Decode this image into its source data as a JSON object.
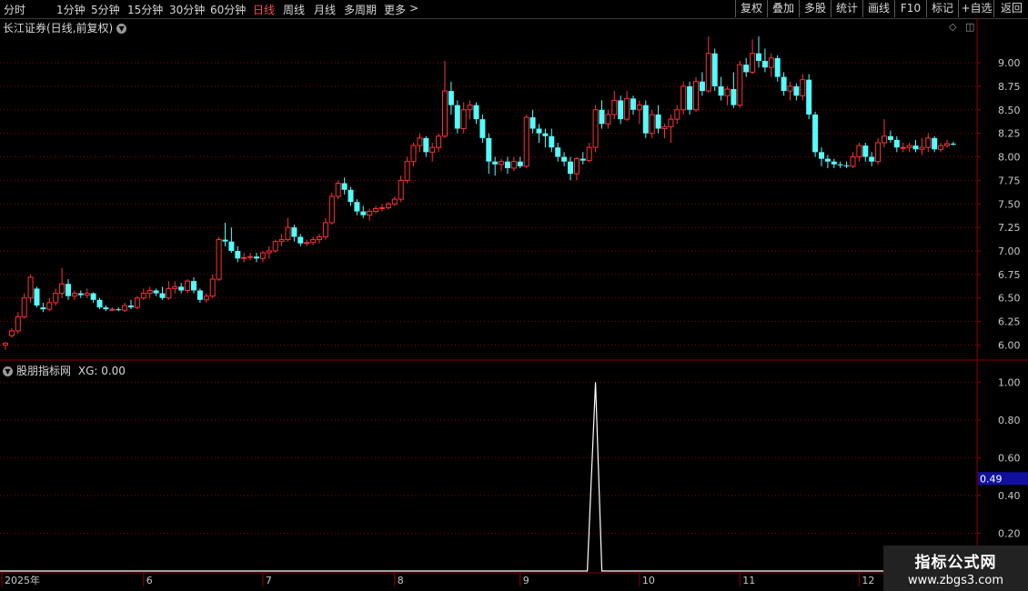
{
  "periods": [
    "分时",
    "1分钟",
    "5分钟",
    "15分钟",
    "30分钟",
    "60分钟",
    "日线",
    "周线",
    "月线",
    "多周期",
    "更多"
  ],
  "active_period": "日线",
  "more_chevron": ">",
  "right_buttons": [
    "复权",
    "叠加",
    "多股",
    "统计",
    "画线",
    "F10",
    "标记",
    "+自选",
    "返回"
  ],
  "stock_title": "长江证券(日线,前复权)",
  "indicator_title": "股朋指标网",
  "indicator_value": "XG: 0.00",
  "indicator_current_badge": "0.49",
  "watermark": {
    "line1": "指标公式网",
    "line2": "www.zbgs3.com"
  },
  "colors": {
    "up": "#ff3232",
    "down": "#54fcfc",
    "grid": "#8b0000",
    "indicator": "#ffffff",
    "badge": "#1010a0"
  },
  "chart_data": [
    {
      "type": "candlestick",
      "title": "长江证券(日线,前复权)",
      "ylim": [
        5.85,
        9.3
      ],
      "yticks": [
        "6.00",
        "6.25",
        "6.50",
        "6.75",
        "7.00",
        "7.25",
        "7.50",
        "7.75",
        "8.00",
        "8.25",
        "8.50",
        "8.75",
        "9.00"
      ],
      "x_labels": [
        "2025年",
        "6",
        "7",
        "8",
        "9",
        "10",
        "11",
        "12"
      ],
      "x_label_index": [
        0,
        22,
        41,
        62,
        82,
        101,
        117,
        136
      ],
      "ohlc": [
        [
          6.0,
          6.03,
          5.95,
          6.02
        ],
        [
          6.1,
          6.18,
          6.08,
          6.15
        ],
        [
          6.15,
          6.35,
          6.12,
          6.3
        ],
        [
          6.3,
          6.55,
          6.28,
          6.5
        ],
        [
          6.5,
          6.75,
          6.45,
          6.72
        ],
        [
          6.6,
          6.62,
          6.4,
          6.42
        ],
        [
          6.4,
          6.45,
          6.35,
          6.38
        ],
        [
          6.38,
          6.5,
          6.36,
          6.45
        ],
        [
          6.45,
          6.6,
          6.42,
          6.55
        ],
        [
          6.55,
          6.82,
          6.5,
          6.65
        ],
        [
          6.65,
          6.7,
          6.48,
          6.52
        ],
        [
          6.52,
          6.58,
          6.48,
          6.55
        ],
        [
          6.55,
          6.58,
          6.5,
          6.53
        ],
        [
          6.53,
          6.6,
          6.5,
          6.55
        ],
        [
          6.55,
          6.56,
          6.45,
          6.48
        ],
        [
          6.48,
          6.5,
          6.38,
          6.4
        ],
        [
          6.4,
          6.42,
          6.36,
          6.38
        ],
        [
          6.38,
          6.4,
          6.36,
          6.38
        ],
        [
          6.38,
          6.4,
          6.36,
          6.37
        ],
        [
          6.37,
          6.45,
          6.35,
          6.42
        ],
        [
          6.42,
          6.48,
          6.38,
          6.4
        ],
        [
          6.4,
          6.52,
          6.38,
          6.5
        ],
        [
          6.5,
          6.6,
          6.48,
          6.55
        ],
        [
          6.55,
          6.62,
          6.5,
          6.58
        ],
        [
          6.58,
          6.6,
          6.52,
          6.55
        ],
        [
          6.55,
          6.62,
          6.48,
          6.5
        ],
        [
          6.5,
          6.68,
          6.48,
          6.6
        ],
        [
          6.6,
          6.68,
          6.55,
          6.62
        ],
        [
          6.62,
          6.66,
          6.55,
          6.58
        ],
        [
          6.58,
          6.7,
          6.55,
          6.68
        ],
        [
          6.68,
          6.72,
          6.55,
          6.58
        ],
        [
          6.58,
          6.6,
          6.45,
          6.48
        ],
        [
          6.48,
          6.55,
          6.45,
          6.52
        ],
        [
          6.52,
          6.75,
          6.5,
          6.7
        ],
        [
          6.7,
          7.15,
          6.68,
          7.12
        ],
        [
          7.12,
          7.3,
          7.05,
          7.1
        ],
        [
          7.1,
          7.25,
          6.98,
          7.0
        ],
        [
          7.0,
          7.05,
          6.88,
          6.92
        ],
        [
          6.92,
          6.98,
          6.88,
          6.93
        ],
        [
          6.93,
          6.98,
          6.9,
          6.94
        ],
        [
          6.94,
          6.98,
          6.88,
          6.92
        ],
        [
          6.92,
          7.0,
          6.88,
          6.98
        ],
        [
          6.98,
          7.05,
          6.92,
          7.0
        ],
        [
          7.0,
          7.12,
          6.98,
          7.1
        ],
        [
          7.1,
          7.18,
          7.05,
          7.12
        ],
        [
          7.12,
          7.35,
          7.1,
          7.25
        ],
        [
          7.25,
          7.28,
          7.1,
          7.15
        ],
        [
          7.15,
          7.18,
          7.05,
          7.08
        ],
        [
          7.08,
          7.12,
          7.05,
          7.09
        ],
        [
          7.09,
          7.15,
          7.06,
          7.12
        ],
        [
          7.12,
          7.18,
          7.08,
          7.15
        ],
        [
          7.15,
          7.35,
          7.12,
          7.3
        ],
        [
          7.3,
          7.62,
          7.28,
          7.58
        ],
        [
          7.58,
          7.75,
          7.55,
          7.72
        ],
        [
          7.72,
          7.78,
          7.6,
          7.65
        ],
        [
          7.65,
          7.68,
          7.48,
          7.52
        ],
        [
          7.52,
          7.55,
          7.38,
          7.42
        ],
        [
          7.42,
          7.48,
          7.35,
          7.38
        ],
        [
          7.38,
          7.45,
          7.32,
          7.42
        ],
        [
          7.42,
          7.48,
          7.4,
          7.45
        ],
        [
          7.45,
          7.5,
          7.42,
          7.46
        ],
        [
          7.46,
          7.52,
          7.44,
          7.5
        ],
        [
          7.5,
          7.58,
          7.48,
          7.55
        ],
        [
          7.55,
          7.8,
          7.52,
          7.75
        ],
        [
          7.75,
          8.0,
          7.72,
          7.95
        ],
        [
          7.95,
          8.15,
          7.9,
          8.12
        ],
        [
          8.12,
          8.25,
          8.05,
          8.2
        ],
        [
          8.2,
          8.22,
          8.0,
          8.05
        ],
        [
          8.05,
          8.15,
          7.95,
          8.1
        ],
        [
          8.1,
          8.25,
          8.05,
          8.22
        ],
        [
          8.22,
          9.02,
          8.2,
          8.7
        ],
        [
          8.7,
          8.8,
          8.45,
          8.55
        ],
        [
          8.55,
          8.6,
          8.25,
          8.3
        ],
        [
          8.3,
          8.58,
          8.25,
          8.5
        ],
        [
          8.5,
          8.6,
          8.4,
          8.55
        ],
        [
          8.55,
          8.58,
          8.35,
          8.4
        ],
        [
          8.4,
          8.45,
          8.15,
          8.2
        ],
        [
          8.2,
          8.25,
          7.82,
          7.95
        ],
        [
          7.95,
          8.0,
          7.8,
          7.92
        ],
        [
          7.92,
          7.98,
          7.85,
          7.95
        ],
        [
          7.95,
          8.0,
          7.82,
          7.88
        ],
        [
          7.88,
          8.0,
          7.85,
          7.95
        ],
        [
          7.95,
          8.0,
          7.88,
          7.9
        ],
        [
          7.9,
          8.45,
          7.88,
          8.42
        ],
        [
          8.42,
          8.5,
          8.25,
          8.3
        ],
        [
          8.3,
          8.35,
          8.15,
          8.25
        ],
        [
          8.25,
          8.3,
          8.1,
          8.22
        ],
        [
          8.22,
          8.3,
          8.05,
          8.1
        ],
        [
          8.1,
          8.15,
          7.95,
          8.0
        ],
        [
          8.0,
          8.05,
          7.9,
          7.95
        ],
        [
          7.95,
          8.0,
          7.75,
          7.82
        ],
        [
          7.82,
          8.0,
          7.75,
          7.98
        ],
        [
          7.98,
          8.05,
          7.92,
          7.96
        ],
        [
          7.96,
          8.15,
          7.94,
          8.1
        ],
        [
          8.1,
          8.55,
          8.05,
          8.5
        ],
        [
          8.5,
          8.6,
          8.3,
          8.35
        ],
        [
          8.35,
          8.5,
          8.3,
          8.45
        ],
        [
          8.45,
          8.7,
          8.4,
          8.6
        ],
        [
          8.6,
          8.65,
          8.35,
          8.4
        ],
        [
          8.4,
          8.7,
          8.38,
          8.62
        ],
        [
          8.62,
          8.65,
          8.45,
          8.5
        ],
        [
          8.5,
          8.6,
          8.35,
          8.55
        ],
        [
          8.55,
          8.6,
          8.2,
          8.25
        ],
        [
          8.25,
          8.5,
          8.2,
          8.45
        ],
        [
          8.45,
          8.55,
          8.25,
          8.3
        ],
        [
          8.3,
          8.35,
          8.2,
          8.32
        ],
        [
          8.32,
          8.45,
          8.15,
          8.4
        ],
        [
          8.4,
          8.55,
          8.35,
          8.5
        ],
        [
          8.5,
          8.8,
          8.45,
          8.75
        ],
        [
          8.75,
          8.8,
          8.45,
          8.5
        ],
        [
          8.5,
          8.85,
          8.48,
          8.8
        ],
        [
          8.8,
          8.9,
          8.65,
          8.7
        ],
        [
          8.7,
          9.28,
          8.68,
          9.1
        ],
        [
          9.1,
          9.15,
          8.7,
          8.75
        ],
        [
          8.75,
          8.85,
          8.6,
          8.65
        ],
        [
          8.65,
          8.75,
          8.55,
          8.72
        ],
        [
          8.72,
          8.9,
          8.52,
          8.55
        ],
        [
          8.55,
          9.02,
          8.52,
          8.98
        ],
        [
          8.98,
          9.05,
          8.85,
          8.9
        ],
        [
          8.9,
          9.25,
          8.88,
          9.1
        ],
        [
          9.1,
          9.28,
          8.95,
          9.02
        ],
        [
          9.02,
          9.15,
          8.9,
          8.95
        ],
        [
          8.95,
          9.1,
          8.85,
          9.05
        ],
        [
          9.05,
          9.08,
          8.8,
          8.85
        ],
        [
          8.85,
          8.9,
          8.65,
          8.7
        ],
        [
          8.7,
          8.8,
          8.6,
          8.75
        ],
        [
          8.75,
          8.78,
          8.6,
          8.65
        ],
        [
          8.65,
          8.88,
          8.6,
          8.82
        ],
        [
          8.82,
          8.88,
          8.4,
          8.45
        ],
        [
          8.45,
          8.48,
          8.0,
          8.05
        ],
        [
          8.05,
          8.1,
          7.9,
          7.98
        ],
        [
          7.98,
          8.02,
          7.88,
          7.95
        ],
        [
          7.95,
          7.98,
          7.88,
          7.92
        ],
        [
          7.92,
          7.95,
          7.88,
          7.91
        ],
        [
          7.91,
          7.95,
          7.88,
          7.9
        ],
        [
          7.9,
          8.05,
          7.88,
          8.0
        ],
        [
          8.0,
          8.15,
          7.95,
          8.12
        ],
        [
          8.12,
          8.15,
          7.95,
          8.0
        ],
        [
          8.0,
          8.05,
          7.9,
          7.95
        ],
        [
          7.95,
          8.2,
          7.92,
          8.15
        ],
        [
          8.15,
          8.4,
          8.1,
          8.22
        ],
        [
          8.22,
          8.28,
          8.15,
          8.18
        ],
        [
          8.18,
          8.22,
          8.05,
          8.1
        ],
        [
          8.1,
          8.15,
          8.05,
          8.1
        ],
        [
          8.1,
          8.15,
          8.05,
          8.12
        ],
        [
          8.12,
          8.18,
          8.05,
          8.08
        ],
        [
          8.08,
          8.2,
          8.02,
          8.1
        ],
        [
          8.1,
          8.25,
          8.05,
          8.2
        ],
        [
          8.2,
          8.22,
          8.05,
          8.08
        ],
        [
          8.08,
          8.15,
          8.05,
          8.12
        ],
        [
          8.12,
          8.18,
          8.1,
          8.14
        ],
        [
          8.14,
          8.16,
          8.12,
          8.13
        ]
      ]
    },
    {
      "type": "line",
      "title": "股朋指标网",
      "series": [
        {
          "name": "XG",
          "spike_index": 94,
          "spike_value": 1.0,
          "baseline": 0.0
        }
      ],
      "ylim": [
        0.0,
        1.05
      ],
      "yticks": [
        "0.20",
        "0.40",
        "0.60",
        "0.80",
        "1.00"
      ],
      "current_badge": 0.49
    }
  ]
}
